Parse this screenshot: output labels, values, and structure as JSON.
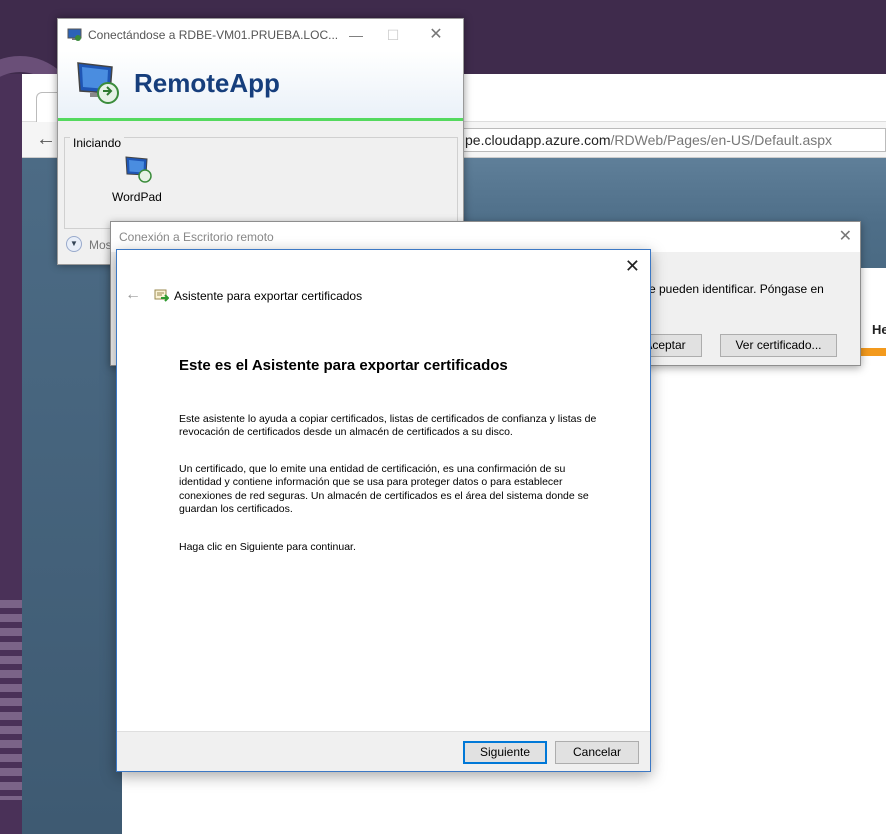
{
  "browser": {
    "address_host": "pe.cloudapp.azure.com",
    "address_path": "/RDWeb/Pages/en-US/Default.aspx",
    "page_partial_text": "He"
  },
  "remoteapp": {
    "title": "Conectándose a RDBE-VM01.PRUEBA.LOC...",
    "header": "RemoteApp",
    "group_label": "Iniciando",
    "app_label": "WordPad",
    "more_label": "Mos"
  },
  "rdc": {
    "title": "Conexión a Escritorio remoto",
    "message": "e pueden identificar. Póngase en",
    "accept_label": "Aceptar",
    "view_cert_label": "Ver certificado..."
  },
  "wizard": {
    "title": "Asistente para exportar certificados",
    "heading": "Este es el Asistente para exportar certificados",
    "para1": "Este asistente lo ayuda a copiar certificados, listas de certificados de confianza y listas de revocación de certificados desde un almacén de certificados a su disco.",
    "para2": "Un certificado, que lo emite una entidad de certificación, es una confirmación de su identidad y contiene información que se usa para proteger datos o para establecer conexiones de red seguras. Un almacén de certificados es el área del sistema donde se guardan los certificados.",
    "para3": "Haga clic en Siguiente para continuar.",
    "next_label": "Siguiente",
    "cancel_label": "Cancelar"
  },
  "icons": {
    "remote_desktop": "remote-desktop-icon",
    "certificate": "certificate-icon",
    "close": "close-icon",
    "back_arrow": "back-arrow-icon",
    "expand": "expand-icon"
  },
  "colors": {
    "remoteapp_title": "#163e7c",
    "progress_green": "#54d95e",
    "wizard_border": "#3c78c4",
    "primary_button_border": "#0078d7"
  }
}
